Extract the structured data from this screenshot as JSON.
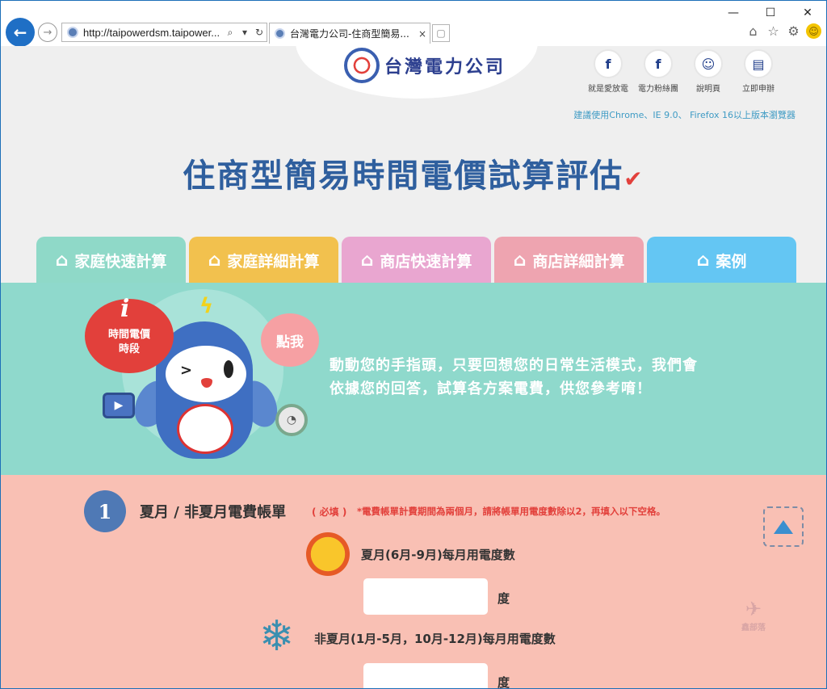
{
  "browser": {
    "url": "http://taipowerdsm.taipower...",
    "tab_title": "台灣電力公司-住商型簡易...",
    "tab_close": "×",
    "win_minimize": "—",
    "win_maximize": "☐",
    "win_close": "✕"
  },
  "header": {
    "logo_text": "台灣電力公司",
    "social": [
      {
        "label": "就是愛放電",
        "icon": "f"
      },
      {
        "label": "電力粉絲團",
        "icon": "f"
      },
      {
        "label": "說明頁",
        "icon": "☺"
      },
      {
        "label": "立即申辦",
        "icon": "▤"
      }
    ],
    "browser_note": "建議使用Chrome、IE 9.0、 Firefox 16以上版本瀏覽器"
  },
  "title": "住商型簡易時間電價試算評估",
  "tabs": [
    {
      "label": "家庭快速計算",
      "icon": "⌂",
      "color": "#8fd9c8"
    },
    {
      "label": "家庭詳細計算",
      "icon": "⌂",
      "color": "#f2c14e"
    },
    {
      "label": "商店快速計算",
      "icon": "⌂",
      "color": "#e9a6d0"
    },
    {
      "label": "商店詳細計算",
      "icon": "⌂",
      "color": "#eea4b0"
    },
    {
      "label": "案例",
      "icon": "⌂",
      "color": "#64c6f3"
    }
  ],
  "hero": {
    "bubble_red_icon": "i",
    "bubble_red_line1": "時間電價",
    "bubble_red_line2": "時段",
    "bubble_pink": "點我",
    "text_line1": "動動您的手指頭，只要回想您的日常生活模式，我們會",
    "text_line2": "依據您的回答，試算各方案電費，供您參考唷！"
  },
  "form": {
    "step_number": "1",
    "step_title": "夏月 / 非夏月電費帳單",
    "required": "( 必填 )",
    "note": "*電費帳單計費期間為兩個月，請將帳單用電度數除以2，再填入以下空格。",
    "summer_label": "夏月(6月-9月)每月用電度數",
    "summer_value": "",
    "winter_label": "非夏月(1月-5月，10月-12月)每月用電度數",
    "winter_value": "",
    "unit": "度",
    "watermark": "鑫部落"
  }
}
